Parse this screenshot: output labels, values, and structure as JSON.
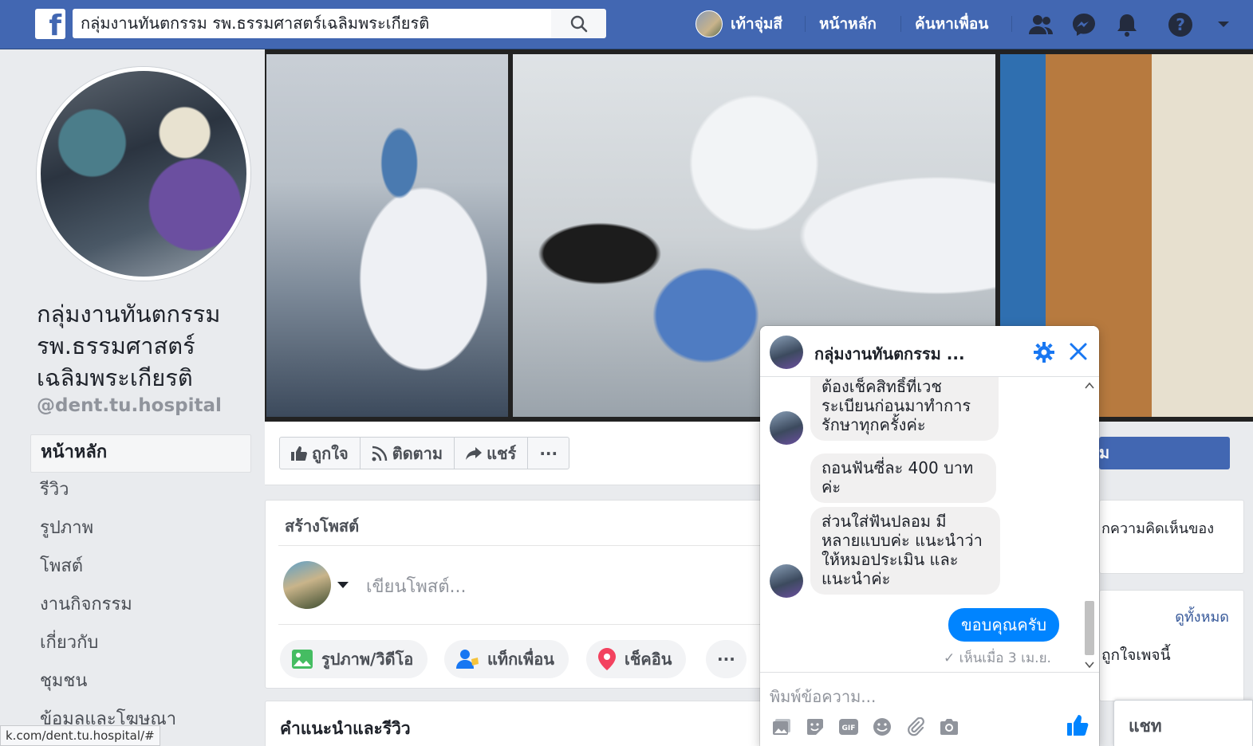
{
  "topbar": {
    "search_value": "กลุ่มงานทันตกรรม รพ.ธรรมศาสตร์เฉลิมพระเกียรติ",
    "profile_name": "เท้าจุ่มสี",
    "home_label": "หน้าหลัก",
    "find_friends_label": "ค้นหาเพื่อน",
    "icons": [
      "facebook-logo-icon",
      "search-icon",
      "friends-icon",
      "messenger-icon",
      "notifications-icon",
      "help-icon",
      "dropdown-arrow-icon"
    ],
    "brand_color": "#4267b2"
  },
  "page": {
    "name": "กลุ่มงานทันตกรรม รพ.ธรรมศาสตร์ เฉลิมพระเกียรติ",
    "name_lines": [
      "กลุ่มงานทันตกรรม",
      "รพ.ธรรมศาสตร์",
      "เฉลิมพระเกียรติ"
    ],
    "handle": "@dent.tu.hospital"
  },
  "sidebar": {
    "items": [
      {
        "label": "หน้าหลัก",
        "active": true
      },
      {
        "label": "รีวิว"
      },
      {
        "label": "รูปภาพ"
      },
      {
        "label": "โพสต์"
      },
      {
        "label": "งานกิจกรรม"
      },
      {
        "label": "เกี่ยวกับ"
      },
      {
        "label": "ชุมชน"
      },
      {
        "label": "ข้อมูลและโฆษณา"
      }
    ]
  },
  "status_url": "k.com/dent.tu.hospital/#",
  "actions": {
    "like": "ถูกใจ",
    "follow": "ติดตาม",
    "share": "แชร์",
    "more": "···",
    "primary_partial": "ม"
  },
  "create_post": {
    "title": "สร้างโพสต์",
    "placeholder": "เขียนโพสต์...",
    "chips": {
      "photo_video": "รูปภาพ/วิดีโอ",
      "tag_friends": "แท็กเพื่อน",
      "check_in": "เช็คอิน",
      "more": "···"
    }
  },
  "recommend": {
    "title": "คำแนะนำและรีวิว"
  },
  "right_col": {
    "opinion_partial": "กความคิดเห็นของ",
    "see_all": "ดูทั้งหมด",
    "likes_partial": "ถูกใจเพจนี้"
  },
  "chat_bar": {
    "label": "แชท"
  },
  "messenger": {
    "title": "กลุ่มงานทันตกรรม ...",
    "messages": [
      {
        "from": "page",
        "lines": [
          "ต้องเช็คสิทธิ์ที่เวช",
          "ระเบียนก่อนมาทำการ",
          "รักษาทุกครั้งค่ะ"
        ]
      },
      {
        "from": "page",
        "lines": [
          "ถอนฟันซี่ละ 400 บาท",
          "ค่ะ"
        ]
      },
      {
        "from": "page",
        "lines": [
          "ส่วนใส่ฟันปลอม มี",
          "หลายแบบค่ะ แนะนำว่า",
          "ให้หมอประเมิน และ",
          "แนะนำค่ะ"
        ]
      },
      {
        "from": "me",
        "text": "ขอบคุณครับ"
      }
    ],
    "seen": "เห็นเมื่อ 3 เม.ย.",
    "input_placeholder": "พิมพ์ข้อความ...",
    "accent": "#0084ff",
    "tool_icons": [
      "photo-icon",
      "sticker-icon",
      "gif-icon",
      "emoji-icon",
      "attachment-icon",
      "camera-icon",
      "like-thumb-icon"
    ]
  }
}
